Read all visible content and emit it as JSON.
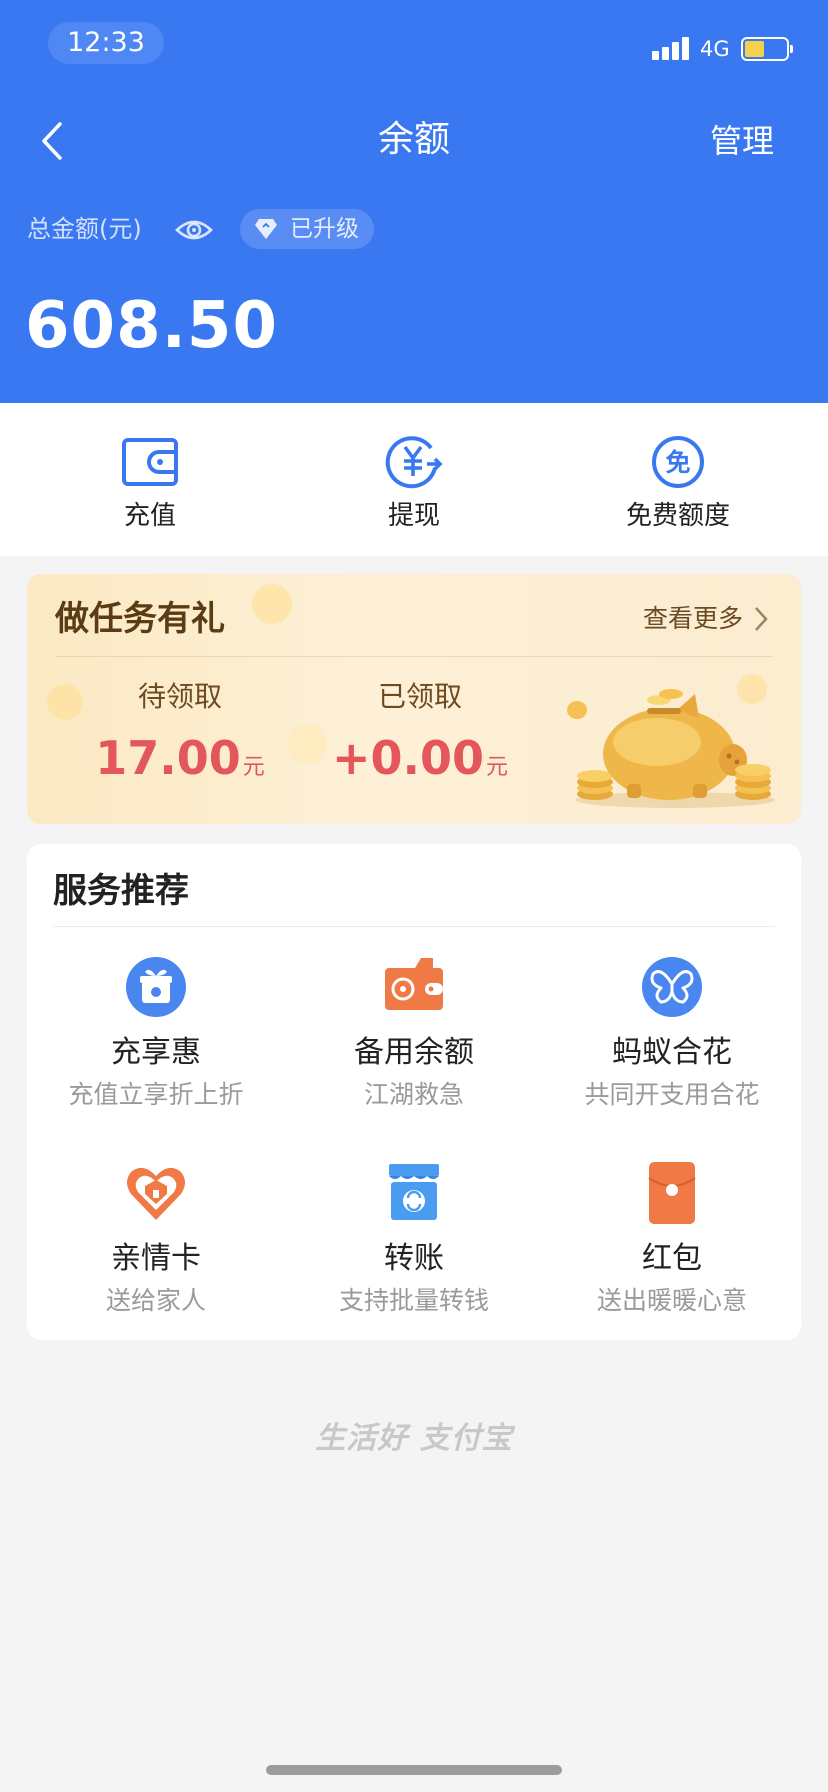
{
  "status_bar": {
    "time": "12:33",
    "network": "4G"
  },
  "nav": {
    "title": "余额",
    "manage_label": "管理"
  },
  "balance_header": {
    "total_label": "总金额(元)",
    "upgrade_label": "已升级",
    "amount": "608.50"
  },
  "actions": [
    {
      "label": "充值",
      "icon": "wallet-icon"
    },
    {
      "label": "提现",
      "icon": "yuan-withdraw-icon"
    },
    {
      "label": "免费额度",
      "icon": "free-quota-icon"
    }
  ],
  "task_card": {
    "title": "做任务有礼",
    "more_label": "查看更多",
    "pending": {
      "caption": "待领取",
      "amount": "17.00",
      "unit": "元"
    },
    "claimed": {
      "caption": "已领取",
      "amount": "+0.00",
      "unit": "元"
    }
  },
  "services": {
    "title": "服务推荐",
    "items": [
      {
        "name": "充享惠",
        "desc": "充值立享折上折",
        "icon": "gift-icon",
        "color": "#4a86f0"
      },
      {
        "name": "备用余额",
        "desc": "江湖救急",
        "icon": "wallet-orange-icon",
        "color": "#f07a45"
      },
      {
        "name": "蚂蚁合花",
        "desc": "共同开支用合花",
        "icon": "butterfly-icon",
        "color": "#4a86f0"
      },
      {
        "name": "亲情卡",
        "desc": "送给家人",
        "icon": "family-heart-icon",
        "color": "#f07a45"
      },
      {
        "name": "转账",
        "desc": "支持批量转钱",
        "icon": "transfer-shop-icon",
        "color": "#4a9cf0"
      },
      {
        "name": "红包",
        "desc": "送出暖暖心意",
        "icon": "red-envelope-icon",
        "color": "#f07a45"
      }
    ]
  },
  "footer": {
    "slogan": "生活好 支付宝"
  },
  "colors": {
    "brand_blue": "#3a78f2",
    "accent_red": "#e3565a",
    "accent_orange": "#f07a45"
  }
}
